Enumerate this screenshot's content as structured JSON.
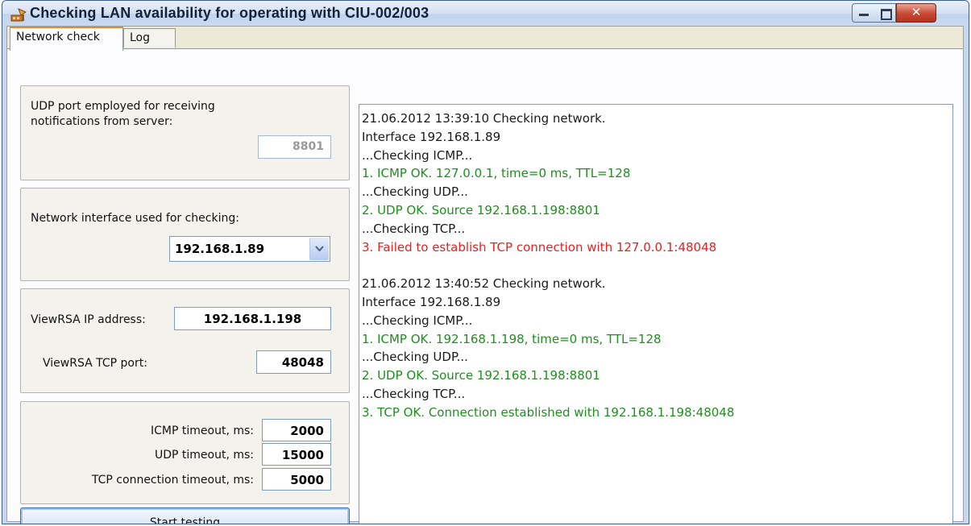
{
  "window": {
    "title": "Checking LAN availability for operating with CIU-002/003",
    "controls": [
      "minimize",
      "maximize",
      "close"
    ]
  },
  "tabs": [
    {
      "label": "Network check",
      "active": true
    },
    {
      "label": "Log",
      "active": false
    }
  ],
  "udp_group": {
    "label_line1": "UDP port employed for receiving",
    "label_line2": "notifications from server:",
    "port_value": "8801"
  },
  "interface_group": {
    "label": "Network interface used for checking:",
    "selected_value": "192.168.1.89"
  },
  "viewrsa_group": {
    "ip_label": "ViewRSA IP address:",
    "ip_value": "192.168.1.198",
    "tcp_port_label": "ViewRSA TCP port:",
    "tcp_port_value": "48048"
  },
  "timeouts_group": {
    "icmp_label": "ICMP timeout, ms:",
    "icmp_value": "2000",
    "udp_label": "UDP timeout, ms:",
    "udp_value": "15000",
    "tcp_label": "TCP connection timeout, ms:",
    "tcp_value": "5000"
  },
  "start_button": {
    "label": "Start testing"
  },
  "colors": {
    "normal": "#1a1a1a",
    "ok": "#1f8f1f",
    "error": "#e82020"
  },
  "log": {
    "lines": [
      {
        "text": "21.06.2012 13:39:10 Checking network.",
        "status": "normal"
      },
      {
        "text": "Interface 192.168.1.89",
        "status": "normal"
      },
      {
        "text": "...Checking ICMP...",
        "status": "normal"
      },
      {
        "text": "1. ICMP OK. 127.0.0.1, time=0 ms, TTL=128",
        "status": "ok"
      },
      {
        "text": "...Checking UDP...",
        "status": "normal"
      },
      {
        "text": "2. UDP OK. Source 192.168.1.198:8801",
        "status": "ok"
      },
      {
        "text": "...Checking TCP...",
        "status": "normal"
      },
      {
        "text": "3. Failed to establish TCP connection with 127.0.0.1:48048",
        "status": "error"
      },
      {
        "text": "",
        "status": "normal"
      },
      {
        "text": "21.06.2012 13:40:52 Checking network.",
        "status": "normal"
      },
      {
        "text": "Interface 192.168.1.89",
        "status": "normal"
      },
      {
        "text": "...Checking ICMP...",
        "status": "normal"
      },
      {
        "text": "1. ICMP OK. 192.168.1.198, time=0 ms, TTL=128",
        "status": "ok"
      },
      {
        "text": "...Checking UDP...",
        "status": "normal"
      },
      {
        "text": "2. UDP OK. Source 192.168.1.198:8801",
        "status": "ok"
      },
      {
        "text": "...Checking TCP...",
        "status": "normal"
      },
      {
        "text": "3. TCP OK. Connection established with 192.168.1.198:48048",
        "status": "ok"
      }
    ]
  }
}
